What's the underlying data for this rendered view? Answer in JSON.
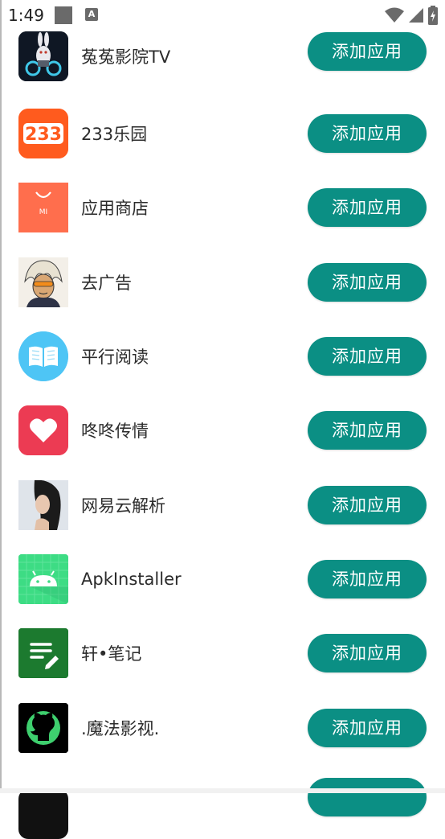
{
  "status_bar": {
    "time": "1:49",
    "notification_icon_letter": "A"
  },
  "apps": [
    {
      "name": "菟菟影院TV",
      "button": "添加应用",
      "icon": "rabbit-robot-icon"
    },
    {
      "name": "233乐园",
      "button": "添加应用",
      "icon": "233-logo-icon"
    },
    {
      "name": "应用商店",
      "button": "添加应用",
      "icon": "mi-store-bag-icon",
      "icon_text": "MI"
    },
    {
      "name": "去广告",
      "button": "添加应用",
      "icon": "cartoon-character-icon"
    },
    {
      "name": "平行阅读",
      "button": "添加应用",
      "icon": "open-book-icon"
    },
    {
      "name": "咚咚传情",
      "button": "添加应用",
      "icon": "heart-icon"
    },
    {
      "name": "网易云解析",
      "button": "添加应用",
      "icon": "portrait-photo-icon"
    },
    {
      "name": "ApkInstaller",
      "button": "添加应用",
      "icon": "android-icon"
    },
    {
      "name": "轩•笔记",
      "button": "添加应用",
      "icon": "note-pen-icon"
    },
    {
      "name": ".魔法影视.",
      "button": "添加应用",
      "icon": "github-icon"
    },
    {
      "name": "",
      "button": "",
      "icon": "partial-app-icon"
    }
  ],
  "colors": {
    "button_bg": "#0b8f84",
    "button_text": "#ffffff"
  }
}
